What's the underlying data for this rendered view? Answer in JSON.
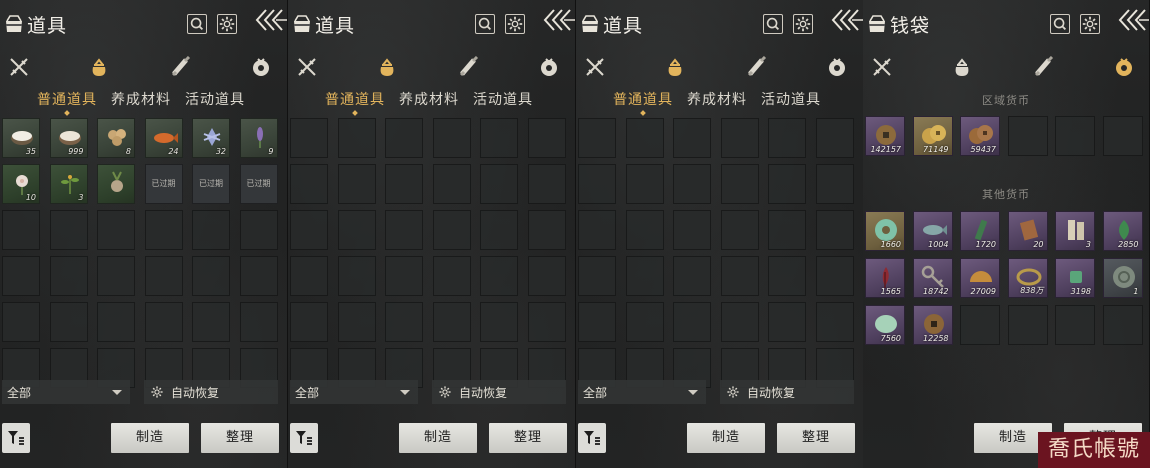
{
  "panels": [
    {
      "title": "道具",
      "tabs": [
        "普通道具",
        "养成材料",
        "活动道具"
      ],
      "active_tab": 0,
      "items": [
        {
          "icon": "rice-bowl-icon",
          "count": "35"
        },
        {
          "icon": "flour-bowl-icon",
          "count": "999"
        },
        {
          "icon": "potatoes-icon",
          "count": "8"
        },
        {
          "icon": "fish-icon",
          "count": "24"
        },
        {
          "icon": "crystal-herb-icon",
          "count": "32"
        },
        {
          "icon": "lavender-icon",
          "count": "9"
        },
        {
          "icon": "white-flower-icon",
          "count": "10"
        },
        {
          "icon": "green-herb-icon",
          "count": "3"
        },
        {
          "icon": "root-herb-icon",
          "count": ""
        },
        {
          "icon": "expired-item-icon",
          "expired": "已过期"
        },
        {
          "icon": "expired-item-icon",
          "expired": "已过期"
        },
        {
          "icon": "expired-item-icon",
          "expired": "已过期"
        }
      ],
      "dropdown": "全部",
      "auto_restore": "自动恢复",
      "buttons": [
        "制造",
        "整理"
      ]
    },
    {
      "title": "道具",
      "tabs": [
        "普通道具",
        "养成材料",
        "活动道具"
      ],
      "active_tab": 0,
      "items": [],
      "dropdown": "全部",
      "auto_restore": "自动恢复",
      "buttons": [
        "制造",
        "整理"
      ]
    },
    {
      "title": "道具",
      "tabs": [
        "普通道具",
        "养成材料",
        "活动道具"
      ],
      "active_tab": 0,
      "items": [],
      "dropdown": "全部",
      "auto_restore": "自动恢复",
      "buttons": [
        "制造",
        "整理"
      ]
    }
  ],
  "wallet": {
    "title": "钱袋",
    "regional_section": "区域货币",
    "regional": [
      {
        "icon": "bronze-coin-icon",
        "count": "142157",
        "tier": "purple"
      },
      {
        "icon": "gold-coins-icon",
        "count": "71149",
        "tier": "gold"
      },
      {
        "icon": "copper-coins-icon",
        "count": "59437",
        "tier": "purple"
      }
    ],
    "other_section": "其他货币",
    "other": [
      {
        "icon": "jade-disc-icon",
        "count": "1660",
        "tier": "gold"
      },
      {
        "icon": "fish-token-icon",
        "count": "1004",
        "tier": "purple"
      },
      {
        "icon": "bamboo-slip-icon",
        "count": "1720",
        "tier": "purple"
      },
      {
        "icon": "seal-tablet-icon",
        "count": "20",
        "tier": "purple"
      },
      {
        "icon": "paper-notes-icon",
        "count": "3",
        "tier": "purple"
      },
      {
        "icon": "green-leaf-icon",
        "count": "2850",
        "tier": "purple"
      },
      {
        "icon": "red-feather-icon",
        "count": "1565",
        "tier": "purple"
      },
      {
        "icon": "key-icon",
        "count": "18742",
        "tier": "purple"
      },
      {
        "icon": "half-disc-icon",
        "count": "27009",
        "tier": "purple"
      },
      {
        "icon": "bracelet-icon",
        "count": "838万",
        "tier": "purple"
      },
      {
        "icon": "jade-piece-icon",
        "count": "3198",
        "tier": "purple"
      },
      {
        "icon": "ancient-coin-icon",
        "count": "1",
        "tier": "gray"
      },
      {
        "icon": "jade-stone-icon",
        "count": "7560",
        "tier": "purple"
      },
      {
        "icon": "square-hole-coin-icon",
        "count": "12258",
        "tier": "purple"
      }
    ],
    "buttons": [
      "制造",
      "整理"
    ]
  },
  "watermark": "喬氏帳號",
  "colors": {
    "accent": "#e2b45c",
    "background": "#1f2020",
    "slot_green": "#3d5139",
    "slot_purple": "#6d5a7d",
    "slot_gold": "#8a7b55"
  }
}
